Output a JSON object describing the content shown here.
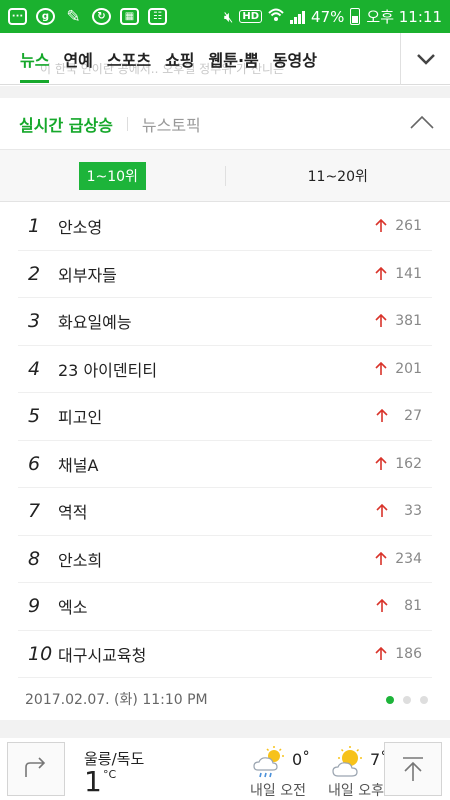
{
  "status_bar": {
    "battery": "47%",
    "time": "오후 11:11",
    "hd": "HD"
  },
  "nav": {
    "tabs": [
      "뉴스",
      "연예",
      "스포츠",
      "쇼핑",
      "웹툰·뿜",
      "동영상"
    ],
    "active_tab": "뉴스",
    "ghost_text": "이 한국 인이란 공에서.. 오후일 정주위 가   산니은"
  },
  "section": {
    "title": "실시간 급상승",
    "subtitle": "뉴스토픽"
  },
  "range_tabs": {
    "active": "1~10위",
    "inactive": "11~20위"
  },
  "ranking": [
    {
      "rank": "1",
      "keyword": "안소영",
      "count": "261"
    },
    {
      "rank": "2",
      "keyword": "외부자들",
      "count": "141"
    },
    {
      "rank": "3",
      "keyword": "화요일예능",
      "count": "381"
    },
    {
      "rank": "4",
      "keyword": "23 아이덴티티",
      "count": "201"
    },
    {
      "rank": "5",
      "keyword": "피고인",
      "count": "27"
    },
    {
      "rank": "6",
      "keyword": "채널A",
      "count": "162"
    },
    {
      "rank": "7",
      "keyword": "역적",
      "count": "33"
    },
    {
      "rank": "8",
      "keyword": "안소희",
      "count": "234"
    },
    {
      "rank": "9",
      "keyword": "엑소",
      "count": "81"
    },
    {
      "rank": "10",
      "keyword": "대구시교육청",
      "count": "186"
    }
  ],
  "timestamp": "2017.02.07. (화) 11:10 PM",
  "pagination": {
    "total": 3,
    "current": 1
  },
  "weather": {
    "location": "울릉/독도",
    "current_temp": "1",
    "unit": "°C",
    "forecast": [
      {
        "label": "내일 오전",
        "temp": "0˚"
      },
      {
        "label": "내일 오후",
        "temp": "7˚"
      }
    ]
  },
  "colors": {
    "brand": "#1bb12f",
    "up_arrow": "#d9342b"
  }
}
